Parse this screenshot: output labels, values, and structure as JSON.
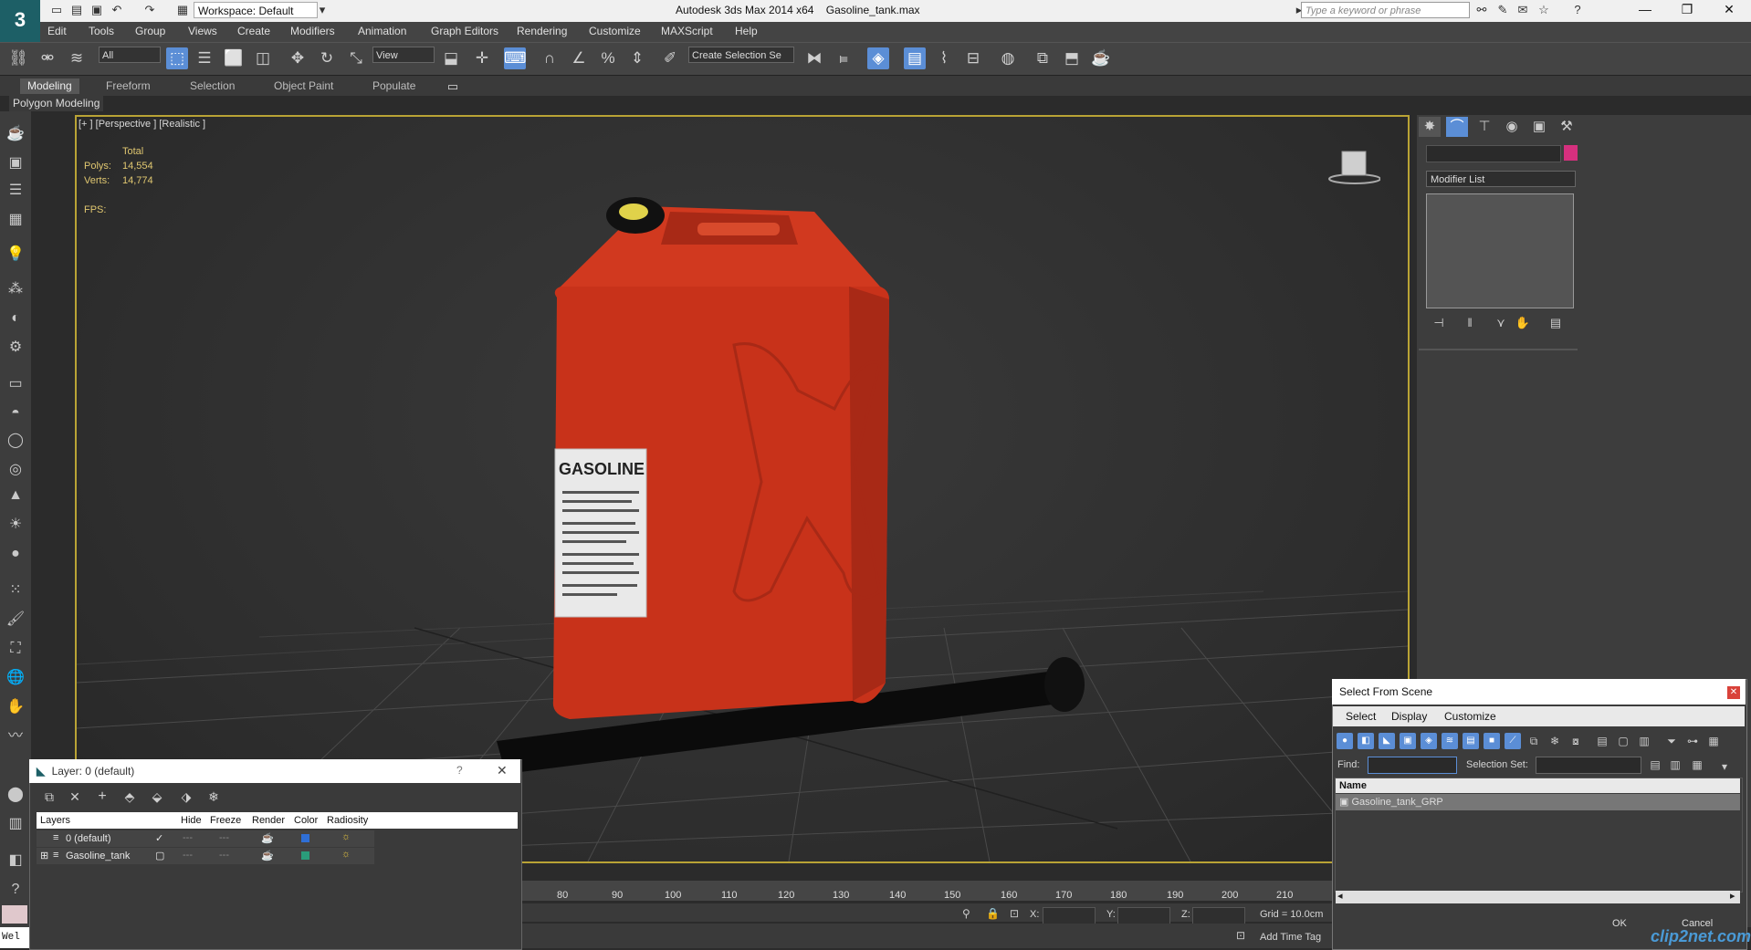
{
  "titlebar": {
    "workspace": "Workspace: Default",
    "app_title": "Autodesk 3ds Max  2014 x64",
    "file_name": "Gasoline_tank.max",
    "search_placeholder": "Type a keyword or phrase"
  },
  "menu": [
    "Edit",
    "Tools",
    "Group",
    "Views",
    "Create",
    "Modifiers",
    "Animation",
    "Graph Editors",
    "Rendering",
    "Customize",
    "MAXScript",
    "Help"
  ],
  "toolbar": {
    "selection_filter": "All",
    "ref_coord": "View",
    "named_selection": "Create Selection Se"
  },
  "ribbon": {
    "tabs": [
      "Modeling",
      "Freeform",
      "Selection",
      "Object Paint",
      "Populate"
    ],
    "active_tab": "Modeling",
    "panel_label": "Polygon Modeling"
  },
  "viewport": {
    "label": "[+ ] [Perspective ] [Realistic ]",
    "stats_header": "Total",
    "polys_label": "Polys:",
    "polys_value": "14,554",
    "verts_label": "Verts:",
    "verts_value": "14,774",
    "fps_label": "FPS:",
    "label_text": "GASOLINE"
  },
  "command_panel": {
    "modifier_list": "Modifier List",
    "object_color": "#d5307e"
  },
  "layer_dialog": {
    "title": "Layer: 0 (default)",
    "columns": [
      "Layers",
      "Hide",
      "Freeze",
      "Render",
      "Color",
      "Radiosity"
    ],
    "rows": [
      {
        "name": "0 (default)",
        "color": "#2f6fd6"
      },
      {
        "name": "Gasoline_tank",
        "color": "#2a9c7a"
      }
    ]
  },
  "select_from_scene": {
    "title": "Select From Scene",
    "menu": [
      "Select",
      "Display",
      "Customize"
    ],
    "find_label": "Find:",
    "selection_set_label": "Selection Set:",
    "name_header": "Name",
    "items": [
      "Gasoline_tank_GRP"
    ],
    "ok": "OK",
    "cancel": "Cancel"
  },
  "timeline": {
    "ticks": [
      "80",
      "90",
      "100",
      "110",
      "120",
      "130",
      "140",
      "150",
      "160",
      "170",
      "180",
      "190",
      "200",
      "210"
    ]
  },
  "status": {
    "x_label": "X:",
    "y_label": "Y:",
    "z_label": "Z:",
    "grid": "Grid = 10.0cm",
    "add_time_tag": "Add Time Tag",
    "listener_text": "Wel"
  },
  "watermark": "clip2net.com",
  "colors": {
    "viewport_border": "#b9a335",
    "accent": "#5b8ed6",
    "canister": "#c8321a"
  }
}
